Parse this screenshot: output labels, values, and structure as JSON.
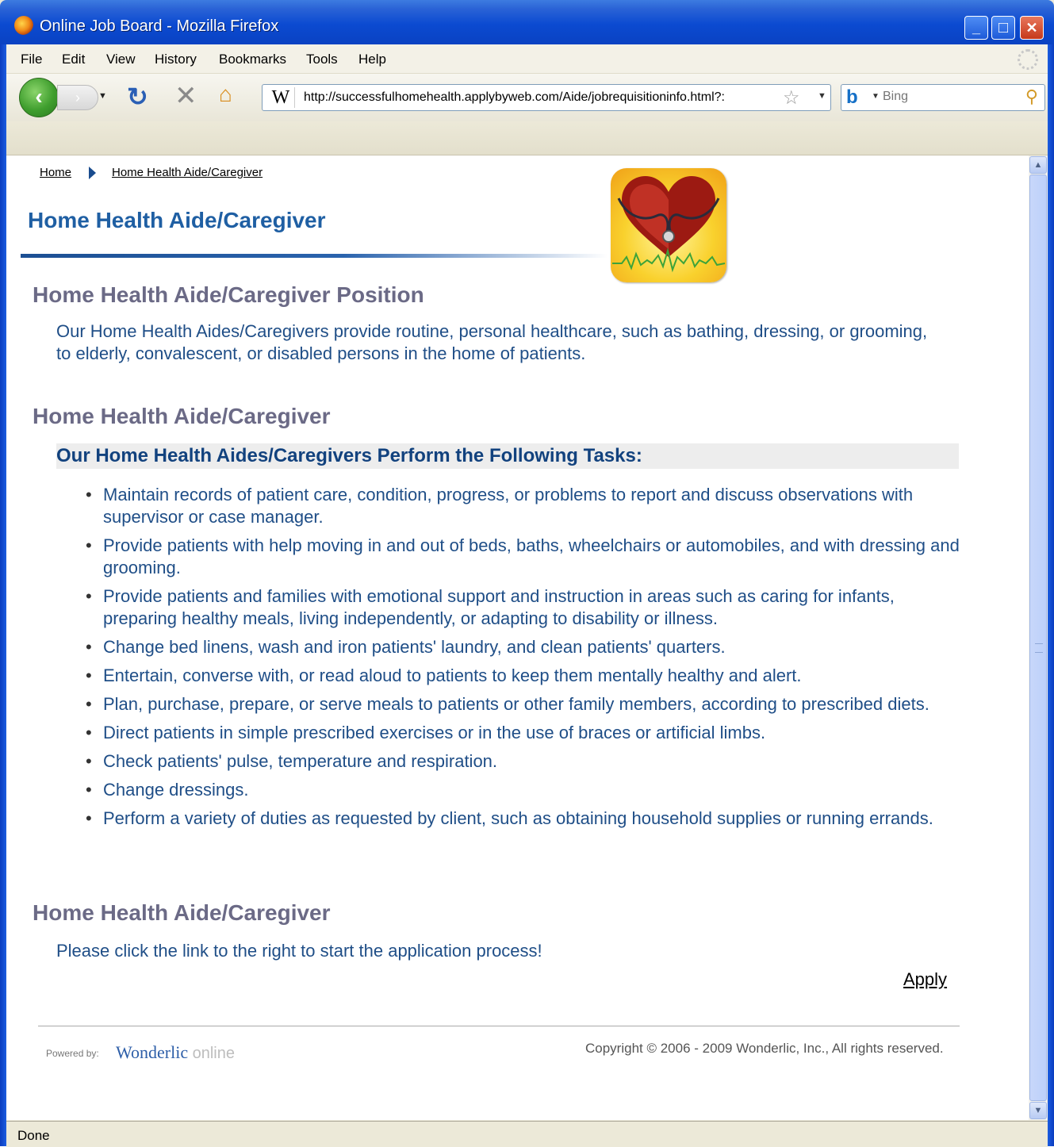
{
  "window": {
    "title": "Online Job Board - Mozilla Firefox",
    "controls": {
      "minimize": "_",
      "maximize": "□",
      "close": "✕"
    }
  },
  "menu": {
    "items": [
      {
        "label": "File"
      },
      {
        "label": "Edit"
      },
      {
        "label": "View"
      },
      {
        "label": "History"
      },
      {
        "label": "Bookmarks"
      },
      {
        "label": "Tools"
      },
      {
        "label": "Help"
      }
    ]
  },
  "toolbar": {
    "url": "http://successfulhomehealth.applybyweb.com/Aide/jobrequisitioninfo.html?:",
    "site_icon": "W",
    "search_placeholder": "Bing",
    "icons": [
      "back-icon",
      "forward-icon",
      "reload-icon",
      "stop-icon",
      "home-icon",
      "bookmark-star-icon",
      "bing-icon",
      "magnifier-icon"
    ]
  },
  "page": {
    "breadcrumb": {
      "home": "Home",
      "current": "Home Health Aide/Caregiver"
    },
    "title": "Home Health Aide/Caregiver",
    "section1": {
      "heading": "Home Health Aide/Caregiver Position",
      "text": "Our Home Health Aides/Caregivers provide routine, personal healthcare, such as bathing, dressing, or grooming, to elderly, convalescent, or disabled persons in the home of patients."
    },
    "section2": {
      "heading": "Home Health Aide/Caregiver",
      "subheading": "Our Home Health Aides/Caregivers Perform the Following Tasks:",
      "tasks": [
        "Maintain records of patient care, condition, progress, or problems to report and discuss observations with supervisor or case manager.",
        "Provide patients with help moving in and out of beds, baths, wheelchairs or automobiles, and with dressing and grooming.",
        "Provide patients and families with emotional support and instruction in areas such as caring for infants, preparing healthy meals, living independently, or adapting to disability or illness.",
        "Change bed linens, wash and iron patients' laundry, and clean patients' quarters.",
        "Entertain, converse with, or read aloud to patients to keep them mentally healthy and alert.",
        "Plan, purchase, prepare, or serve meals to patients or other family members, according to prescribed diets.",
        "Direct patients in simple prescribed exercises or in the use of braces or artificial limbs.",
        "Check patients' pulse, temperature and respiration.",
        "Change dressings.",
        "Perform a variety of duties as requested by client, such as obtaining household supplies or running errands."
      ]
    },
    "section3": {
      "heading": "Home Health Aide/Caregiver",
      "text": "Please click the link to the right to start the application process!",
      "apply_link": "Apply"
    },
    "footer": {
      "powered_by": "Powered by:",
      "brand": "Wonderlic",
      "brand_suffix": "online",
      "copyright": "Copyright © 2006 - 2009 Wonderlic, Inc., All rights reserved."
    }
  },
  "status": {
    "text": "Done"
  },
  "colors": {
    "heading_blue": "#1f5fa3",
    "section_gray": "#6b6a86",
    "body_blue": "#1f4e87",
    "xp_title_blue": "#0b4ad1"
  }
}
